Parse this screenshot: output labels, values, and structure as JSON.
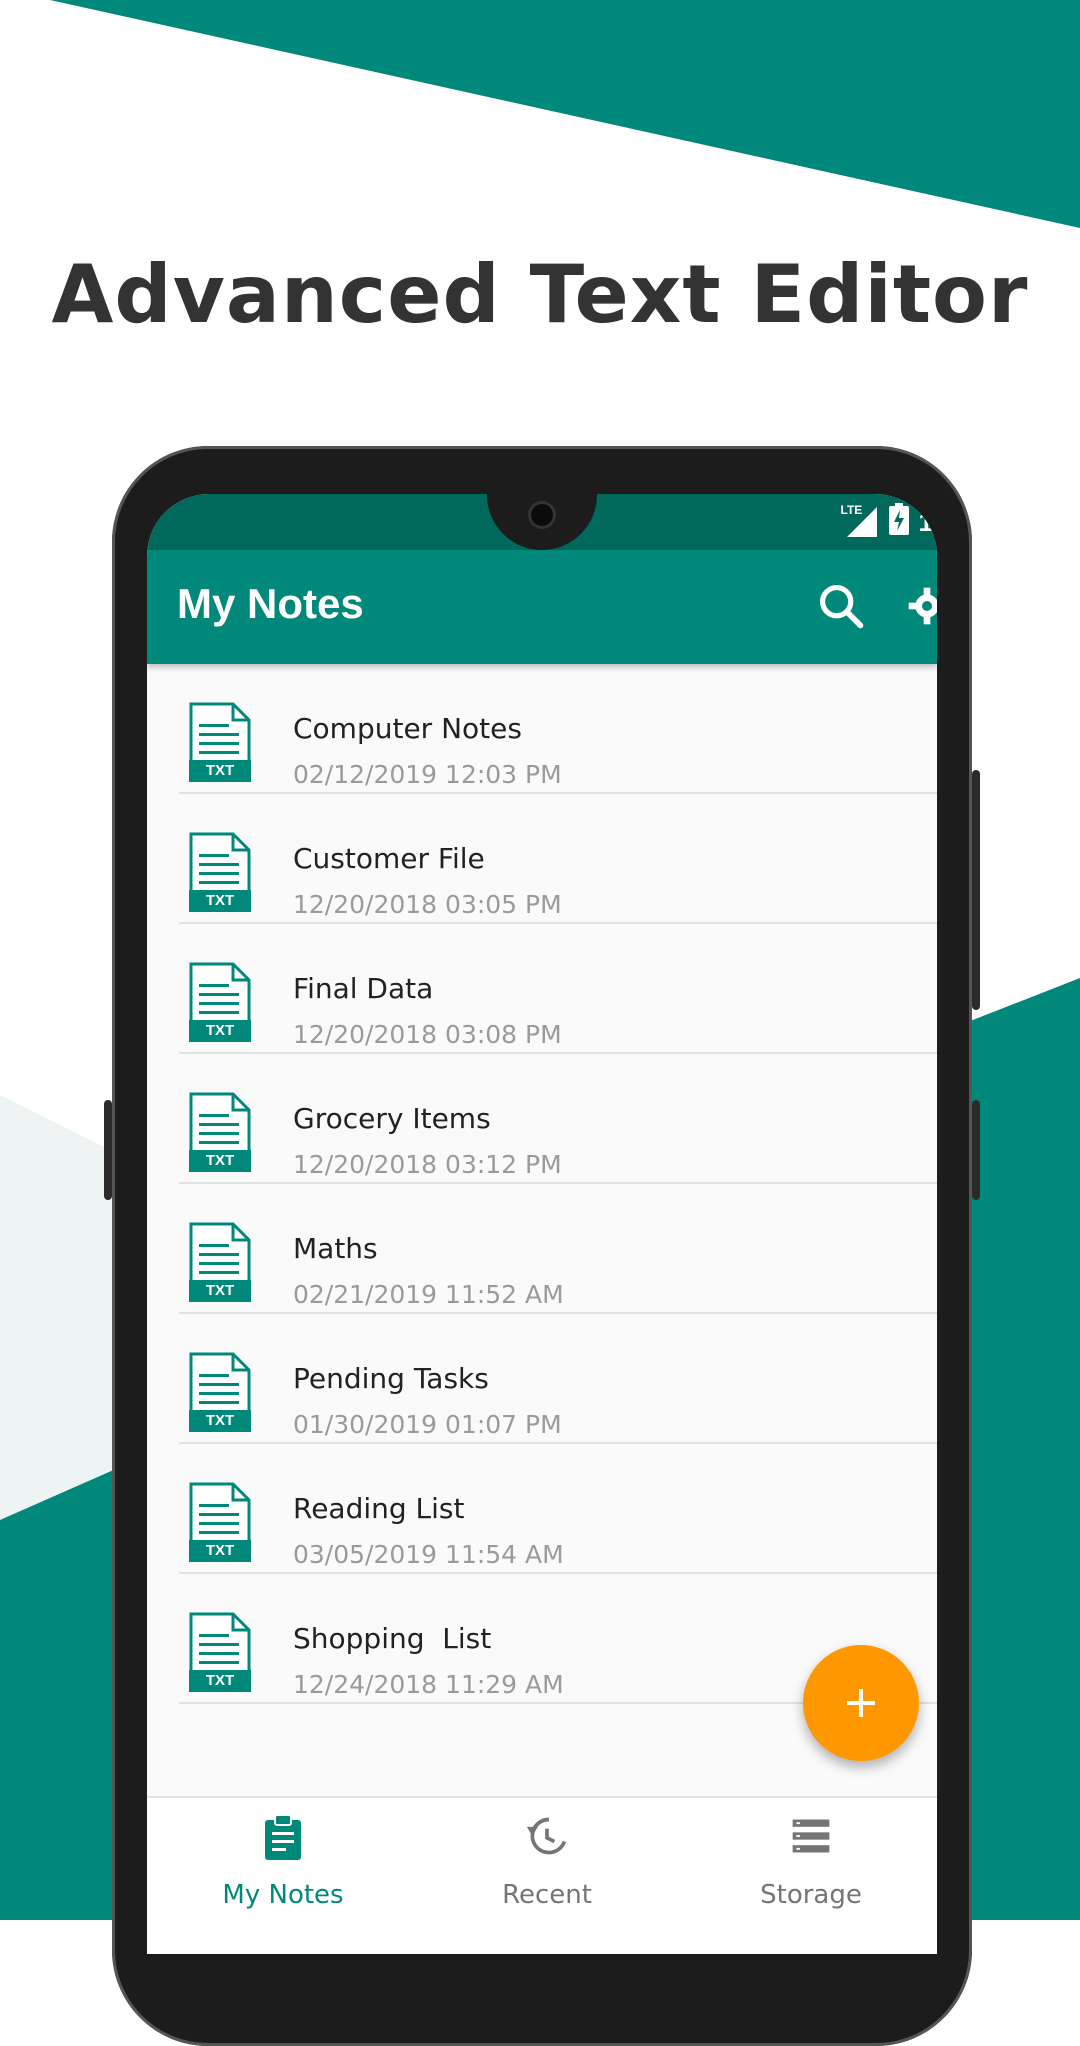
{
  "colors": {
    "primary": "#00897b",
    "primary_dark": "#00695c",
    "accent": "#ff9800",
    "headline": "#333333",
    "date_text": "#9a9a9a",
    "nav_inactive": "#757575"
  },
  "headline": "Advanced Text Editor",
  "status_bar": {
    "network": "LTE",
    "time_partial": "1"
  },
  "app_bar": {
    "title": "My Notes",
    "search_icon": "search-icon",
    "more_icon": "overflow-icon"
  },
  "file_icon": {
    "label": "TXT"
  },
  "notes": [
    {
      "title": "Computer Notes",
      "date": "02/12/2019 12:03 PM"
    },
    {
      "title": "Customer File",
      "date": "12/20/2018 03:05 PM"
    },
    {
      "title": "Final Data",
      "date": "12/20/2018 03:08 PM"
    },
    {
      "title": "Grocery Items",
      "date": "12/20/2018 03:12 PM"
    },
    {
      "title": "Maths",
      "date": "02/21/2019 11:52 AM"
    },
    {
      "title": "Pending Tasks",
      "date": "01/30/2019 01:07 PM"
    },
    {
      "title": "Reading List",
      "date": "03/05/2019 11:54 AM"
    },
    {
      "title": "Shopping  List",
      "date": "12/24/2018 11:29 AM"
    }
  ],
  "fab": {
    "icon": "plus-icon"
  },
  "bottom_nav": [
    {
      "label": "My Notes",
      "icon": "clipboard-icon",
      "active": true
    },
    {
      "label": "Recent",
      "icon": "history-icon",
      "active": false
    },
    {
      "label": "Storage",
      "icon": "storage-icon",
      "active": false
    }
  ]
}
